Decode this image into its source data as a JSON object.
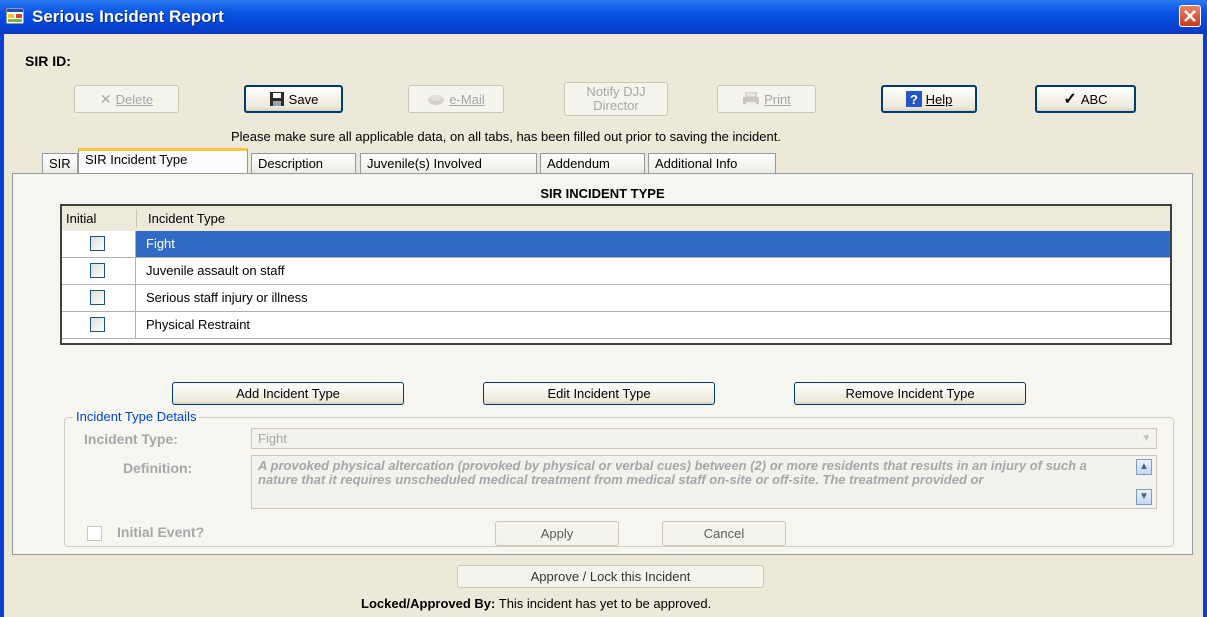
{
  "window": {
    "title": "Serious Incident Report",
    "close_label": "×"
  },
  "header": {
    "sir_id_label": "SIR ID:"
  },
  "toolbar": {
    "delete_label": "Delete",
    "save_label": "Save",
    "email_label": "e-Mail",
    "notify_line1": "Notify DJJ",
    "notify_line2": "Director",
    "print_label": "Print",
    "help_label": "Help",
    "spell_label": "ABC"
  },
  "notice": "Please make sure all applicable data, on all tabs, has been filled out prior to saving the incident.",
  "tabs": [
    {
      "label": "SIR"
    },
    {
      "label": "SIR Incident Type"
    },
    {
      "label": "Description"
    },
    {
      "label": "Juvenile(s) Involved"
    },
    {
      "label": "Addendum"
    },
    {
      "label": "Additional Info"
    }
  ],
  "panel": {
    "title": "SIR INCIDENT TYPE",
    "columns": [
      "Initial",
      "Incident Type"
    ],
    "rows": [
      {
        "type": "Fight",
        "initial": false,
        "selected": true
      },
      {
        "type": "Juvenile assault on staff",
        "initial": false,
        "selected": false
      },
      {
        "type": "Serious staff injury or illness",
        "initial": false,
        "selected": false
      },
      {
        "type": "Physical Restraint",
        "initial": false,
        "selected": false
      }
    ],
    "add_label": "Add Incident Type",
    "edit_label": "Edit Incident Type",
    "remove_label": "Remove Incident Type"
  },
  "details": {
    "legend": "Incident Type Details",
    "incident_type_label": "Incident Type:",
    "incident_type_value": "Fight",
    "definition_label": "Definition:",
    "definition_text": "A provoked physical altercation (provoked by physical or verbal cues) between (2) or more residents that results in an injury of such a nature that it requires unscheduled medical treatment from medical staff on-site or off-site. The treatment provided or",
    "initial_event_label": "Initial Event?",
    "apply_label": "Apply",
    "cancel_label": "Cancel"
  },
  "footer": {
    "approve_label": "Approve / Lock this Incident",
    "locked_label": "Locked/Approved By:",
    "locked_value": "This incident has yet to be approved."
  },
  "colors": {
    "titlebar": "#0a56e6",
    "selection": "#316ac5",
    "window_bg": "#ece9d8",
    "disabled_text": "#a7a6aa"
  }
}
